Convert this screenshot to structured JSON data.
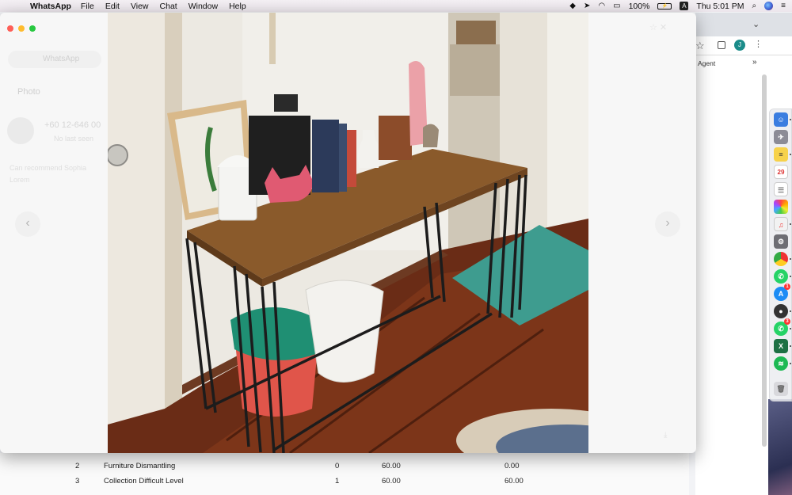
{
  "menubar": {
    "apple_icon": "apple-icon",
    "app_name": "WhatsApp",
    "menus": [
      "File",
      "Edit",
      "View",
      "Chat",
      "Window",
      "Help"
    ],
    "battery": "100%",
    "battery_icon_text": "⚡",
    "input_source": "A",
    "clock": "Thu 5:01 PM"
  },
  "chrome": {
    "profile_initial": "J",
    "bookmark_label": "Agent",
    "bookmark_more": "»"
  },
  "background_table": {
    "rows": [
      {
        "no": "2",
        "desc": "Furniture Dismantling",
        "qty": "0",
        "price": "60.00",
        "total": "0.00"
      },
      {
        "no": "3",
        "desc": "Collection Difficult Level",
        "qty": "1",
        "price": "60.00",
        "total": "60.00"
      }
    ]
  },
  "whatsapp_viewer": {
    "back_label": "WhatsApp",
    "info_heading": "Photo",
    "contact_phone": "+60 12-646 00",
    "contact_sub": "No last seen",
    "faded_msg_1": "Can recommend Sophia",
    "faded_msg_2": "Lorem",
    "prev_arrow": "‹",
    "next_arrow": "›"
  },
  "dock": {
    "calendar_day": "29",
    "appstore_badge": "1",
    "whatsapp_badge": "3"
  }
}
